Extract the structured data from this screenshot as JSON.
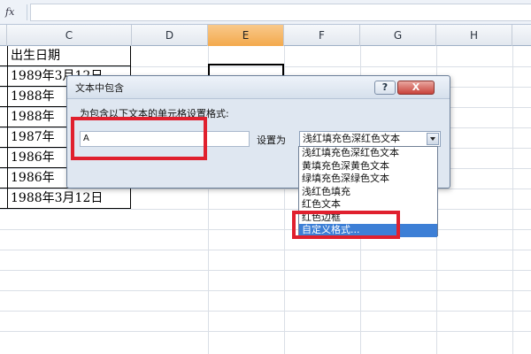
{
  "formula_bar": {
    "fx_label": "fx",
    "value": ""
  },
  "columns": [
    "C",
    "D",
    "E",
    "F",
    "G",
    "H"
  ],
  "selected_column": "E",
  "cells_c": [
    "出生日期",
    "1989年3月12日",
    "1988年",
    "1988年",
    "1987年",
    "1986年",
    "1986年",
    "1988年3月12日"
  ],
  "dialog": {
    "title": "文本中包含",
    "help": "?",
    "close": "X",
    "prompt": "为包含以下文本的单元格设置格式:",
    "text_value": "A",
    "set_as_label": "设置为",
    "selected_format": "浅红填充色深红色文本"
  },
  "dropdown_options": [
    "浅红填充色深红色文本",
    "黄填充色深黄色文本",
    "绿填充色深绿色文本",
    "浅红色填充",
    "红色文本",
    "红色边框",
    "自定义格式..."
  ],
  "highlighted_option": "自定义格式...",
  "colors": {
    "highlight": "#e0202e",
    "selected_column": "#f3a94c",
    "selection": "#3d7fd6"
  }
}
